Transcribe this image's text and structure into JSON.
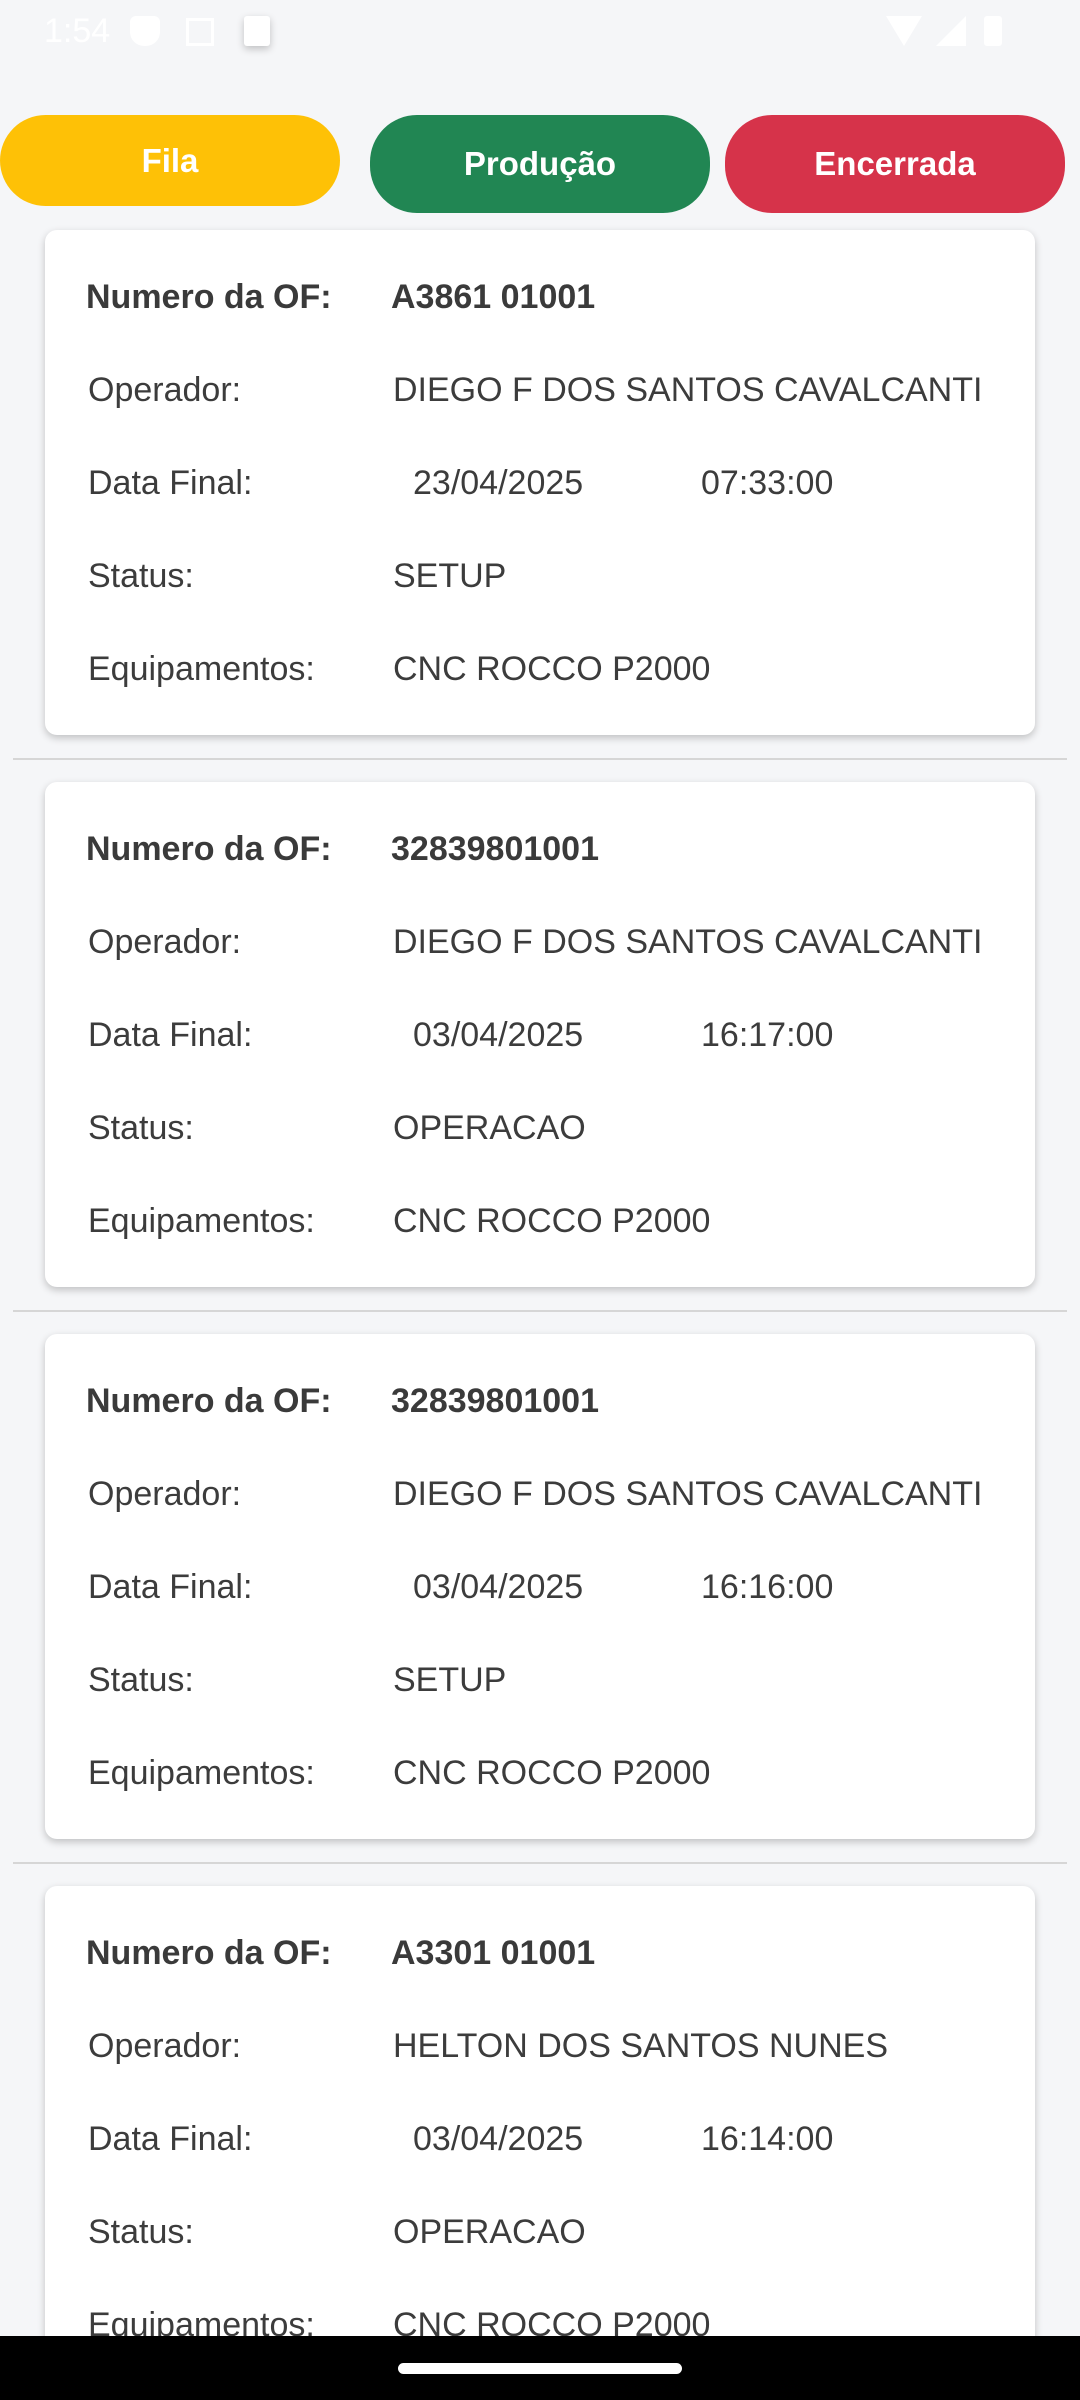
{
  "status_bar": {
    "time": "1:54",
    "icons": [
      "shield-icon",
      "a-box-icon",
      "card-icon",
      "wifi-icon",
      "signal-icon",
      "battery-icon"
    ]
  },
  "tabs": [
    {
      "label": "Fila",
      "color": "#fec106"
    },
    {
      "label": "Produção",
      "color": "#218653"
    },
    {
      "label": "Encerrada",
      "color": "#d6334a"
    }
  ],
  "labels": {
    "of": "Numero da OF:",
    "operador": "Operador:",
    "data_final": "Data Final:",
    "status": "Status:",
    "equipamentos": "Equipamentos:"
  },
  "records": [
    {
      "of": "A3861 01001",
      "operador": "DIEGO F DOS SANTOS CAVALCANTI",
      "data": "23/04/2025",
      "hora": "07:33:00",
      "status": "SETUP",
      "equipamentos": "CNC ROCCO P2000"
    },
    {
      "of": "32839801001",
      "operador": "DIEGO F DOS SANTOS CAVALCANTI",
      "data": "03/04/2025",
      "hora": "16:17:00",
      "status": "OPERACAO",
      "equipamentos": "CNC ROCCO P2000"
    },
    {
      "of": "32839801001",
      "operador": "DIEGO F DOS SANTOS CAVALCANTI",
      "data": "03/04/2025",
      "hora": "16:16:00",
      "status": "SETUP",
      "equipamentos": "CNC ROCCO P2000"
    },
    {
      "of": "A3301 01001",
      "operador": "HELTON DOS SANTOS NUNES",
      "data": "03/04/2025",
      "hora": "16:14:00",
      "status": "OPERACAO",
      "equipamentos": "CNC ROCCO P2000"
    }
  ]
}
